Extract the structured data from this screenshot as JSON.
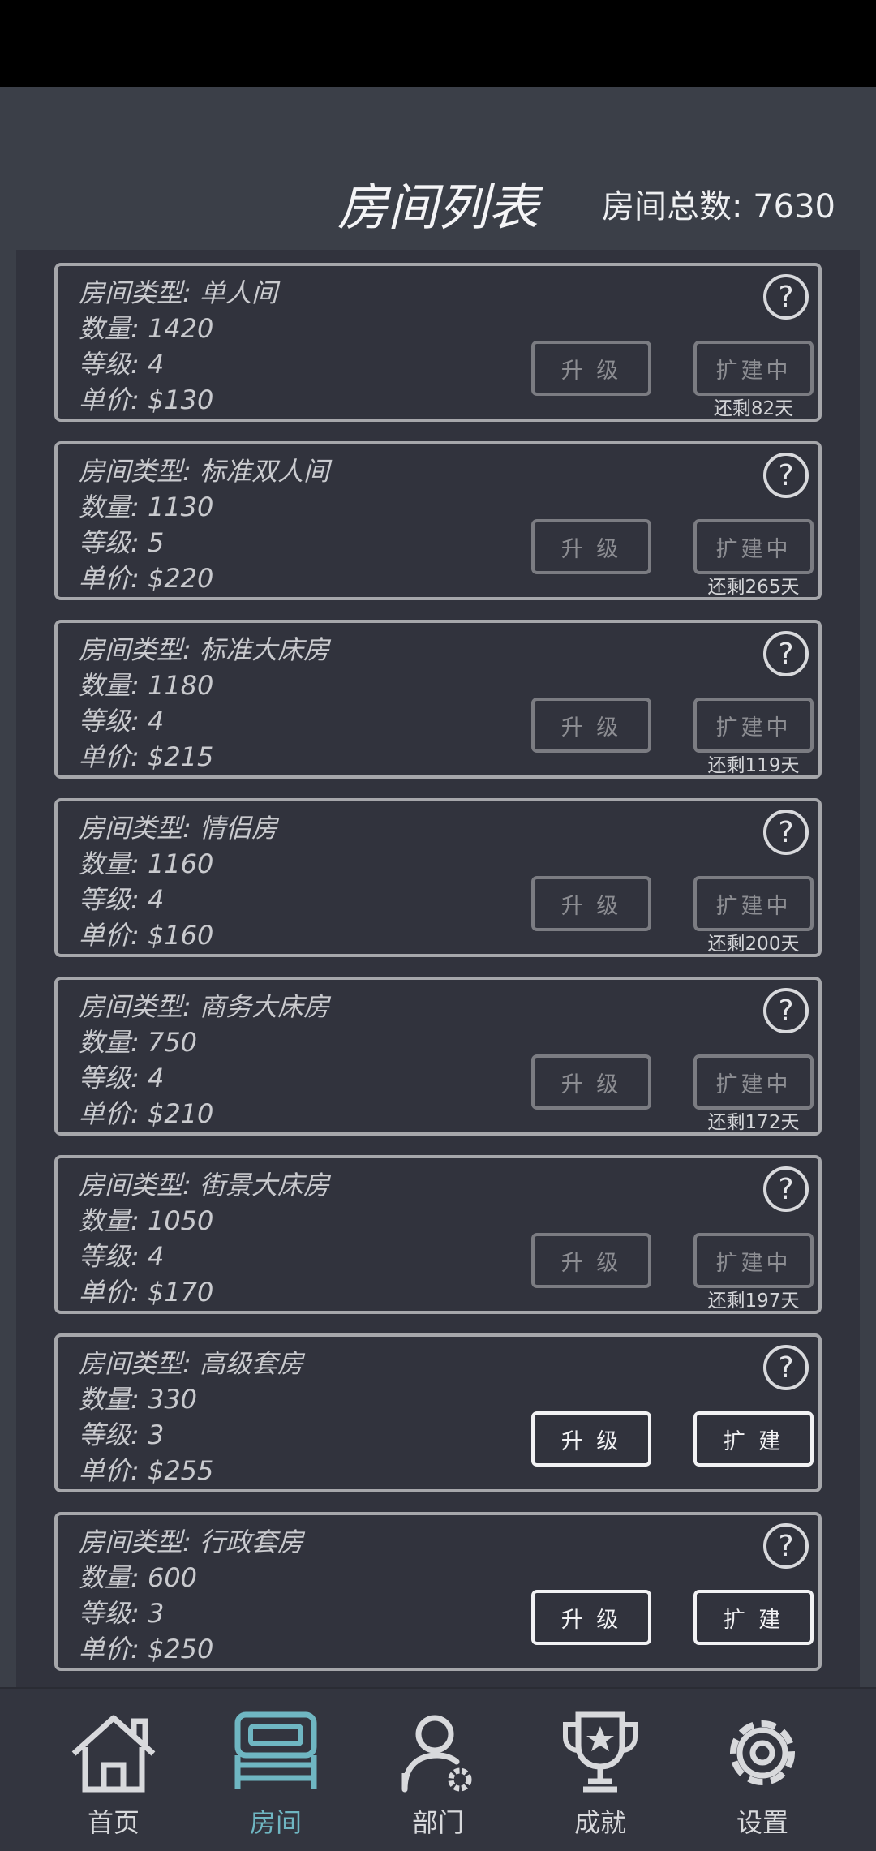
{
  "header": {
    "title": "房间列表",
    "total_label": "房间总数: 7630"
  },
  "rooms": [
    {
      "type": "房间类型: 单人间",
      "count": "数量: 1420",
      "level": "等级: 4",
      "price": "单价: $130",
      "upgrade_label": "升 级",
      "expand_label": "扩建中",
      "remaining": "还剩82天",
      "active": false
    },
    {
      "type": "房间类型: 标准双人间",
      "count": "数量: 1130",
      "level": "等级: 5",
      "price": "单价: $220",
      "upgrade_label": "升 级",
      "expand_label": "扩建中",
      "remaining": "还剩265天",
      "active": false
    },
    {
      "type": "房间类型: 标准大床房",
      "count": "数量: 1180",
      "level": "等级: 4",
      "price": "单价: $215",
      "upgrade_label": "升 级",
      "expand_label": "扩建中",
      "remaining": "还剩119天",
      "active": false
    },
    {
      "type": "房间类型: 情侣房",
      "count": "数量: 1160",
      "level": "等级: 4",
      "price": "单价: $160",
      "upgrade_label": "升 级",
      "expand_label": "扩建中",
      "remaining": "还剩200天",
      "active": false
    },
    {
      "type": "房间类型: 商务大床房",
      "count": "数量: 750",
      "level": "等级: 4",
      "price": "单价: $210",
      "upgrade_label": "升 级",
      "expand_label": "扩建中",
      "remaining": "还剩172天",
      "active": false
    },
    {
      "type": "房间类型: 街景大床房",
      "count": "数量: 1050",
      "level": "等级: 4",
      "price": "单价: $170",
      "upgrade_label": "升 级",
      "expand_label": "扩建中",
      "remaining": "还剩197天",
      "active": false
    },
    {
      "type": "房间类型: 高级套房",
      "count": "数量: 330",
      "level": "等级: 3",
      "price": "单价: $255",
      "upgrade_label": "升 级",
      "expand_label": "扩 建",
      "remaining": "",
      "active": true
    },
    {
      "type": "房间类型: 行政套房",
      "count": "数量: 600",
      "level": "等级: 3",
      "price": "单价: $250",
      "upgrade_label": "升 级",
      "expand_label": "扩 建",
      "remaining": "",
      "active": true
    }
  ],
  "help_glyph": "?",
  "nav": [
    {
      "label": "首页",
      "icon": "home-icon",
      "active": false
    },
    {
      "label": "房间",
      "icon": "bed-icon",
      "active": true
    },
    {
      "label": "部门",
      "icon": "staff-gear-icon",
      "active": false
    },
    {
      "label": "成就",
      "icon": "trophy-icon",
      "active": false
    },
    {
      "label": "设置",
      "icon": "gear-icon",
      "active": false
    }
  ],
  "colors": {
    "active_nav": "#6fb6c2",
    "background": "#3b3f48",
    "panel": "#31333d"
  }
}
